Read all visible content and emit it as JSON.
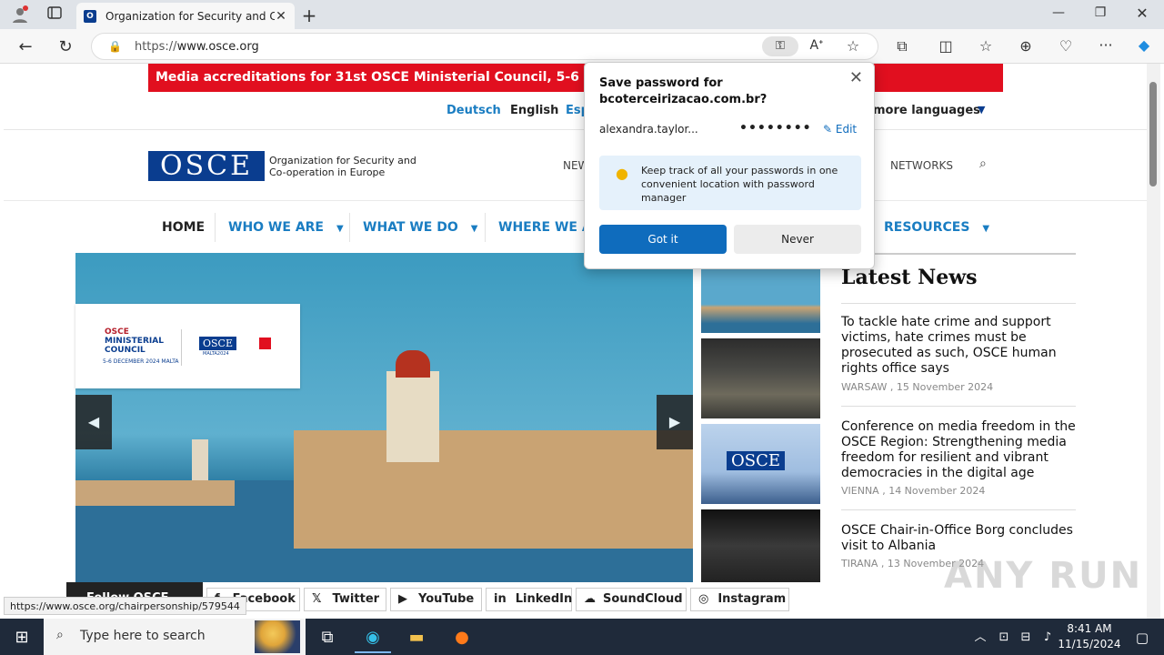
{
  "browser": {
    "tab_title": "Organization for Security and Co",
    "url_prefix": "https://",
    "url_host": "www.osce.org",
    "status_url": "https://www.osce.org/chairpersonship/579544"
  },
  "banner": {
    "text": "Media accreditations for 31st OSCE Ministerial Council, 5-6 December"
  },
  "languages": {
    "items": [
      "Deutsch",
      "English",
      "Esp"
    ],
    "more": "more languages"
  },
  "logo": {
    "mark": "OSCE",
    "line1": "Organization for Security and",
    "line2": "Co-operation in Europe"
  },
  "topnav": {
    "news": "NEW",
    "networks": "NETWORKS"
  },
  "mainnav": {
    "home": "HOME",
    "who": "WHO WE ARE",
    "what": "WHAT WE DO",
    "where": "WHERE WE AR",
    "resources": "RESOURCES"
  },
  "hero": {
    "card_line1": "OSCE",
    "card_line2": "MINISTERIAL",
    "card_line3": "COUNCIL",
    "card_date": "5-6 DECEMBER 2024  MALTA",
    "card_logo": "OSCE",
    "card_logo_sub": "MALTA2024"
  },
  "news": {
    "heading": "Latest News",
    "items": [
      {
        "title": "To tackle hate crime and support victims, hate crimes must be prosecuted as such, OSCE human rights office says",
        "meta": "WARSAW , 15 November 2024"
      },
      {
        "title": "Conference on media freedom in the OSCE Region: Strengthening media freedom for resilient and vibrant democracies in the digital age",
        "meta": "VIENNA , 14 November 2024"
      },
      {
        "title": "OSCE Chair-in-Office Borg concludes visit to Albania",
        "meta": "TIRANA , 13 November 2024"
      }
    ]
  },
  "social": {
    "follow": "Follow OSCE",
    "facebook": "Facebook",
    "twitter": "Twitter",
    "youtube": "YouTube",
    "linkedin": "LinkedIn",
    "soundcloud": "SoundCloud",
    "instagram": "Instagram"
  },
  "password_popup": {
    "title_line1": "Save password for",
    "title_line2": "bcoterceirizacao.com.br?",
    "username": "alexandra.taylor...",
    "password_mask": "••••••••",
    "edit": "Edit",
    "info": "Keep track of all your passwords in one convenient location with password manager",
    "got_it": "Got it",
    "never": "Never"
  },
  "taskbar": {
    "search_placeholder": "Here to search",
    "search_text": "Type here to search",
    "time": "8:41 AM",
    "date": "11/15/2024"
  },
  "watermark": "ANY RUN",
  "colors": {
    "accent_blue": "#1a7dc2",
    "osce_blue": "#0a3d8f",
    "banner_red": "#e10f1f",
    "edge_blue": "#0f6cbd"
  }
}
